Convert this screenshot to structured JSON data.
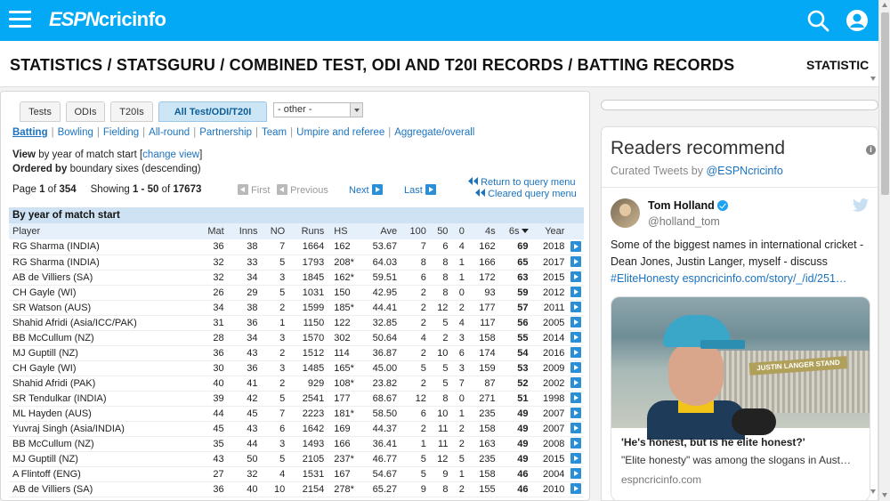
{
  "header": {
    "logo_espn": "ESPN",
    "logo_cric": "cricinfo",
    "icons": {
      "menu": "hamburger-icon",
      "search": "search-icon",
      "user": "user-icon"
    }
  },
  "title": {
    "main": "STATISTICS / STATSGURU / COMBINED TEST, ODI AND T20I RECORDS / BATTING RECORDS",
    "secondary": "STATISTIC"
  },
  "tabs": [
    {
      "label": "Tests"
    },
    {
      "label": "ODIs"
    },
    {
      "label": "T20Is"
    },
    {
      "label": "All Test/ODI/T20I",
      "active": true
    }
  ],
  "select": {
    "value": "- other -"
  },
  "subnav": [
    {
      "label": "Batting",
      "active": true
    },
    {
      "label": "Bowling"
    },
    {
      "label": "Fielding"
    },
    {
      "label": "All-round"
    },
    {
      "label": "Partnership"
    },
    {
      "label": "Team"
    },
    {
      "label": "Umpire and referee"
    },
    {
      "label": "Aggregate/overall"
    }
  ],
  "view": {
    "view_label": "View",
    "view_text": "by year of match start [",
    "change_view": "change view",
    "close_bracket": "]",
    "ordered_label": "Ordered by",
    "ordered_text": "boundary sixes (descending)"
  },
  "pager": {
    "page_label": "Page",
    "page": "1",
    "of": "of",
    "total_pages": "354",
    "showing_label": "Showing",
    "range": "1 - 50",
    "of2": "of",
    "total": "17673",
    "first": "First",
    "previous": "Previous",
    "next": "Next",
    "last": "Last",
    "return_link": "Return to query menu",
    "cleared_link": "Cleared query menu"
  },
  "table": {
    "caption": "By year of match start",
    "headers": [
      "Player",
      "Mat",
      "Inns",
      "NO",
      "Runs",
      "HS",
      "Ave",
      "100",
      "50",
      "0",
      "4s",
      "6s",
      "Year"
    ],
    "rows": [
      [
        "RG Sharma (INDIA)",
        "36",
        "38",
        "7",
        "1664",
        "162",
        "53.67",
        "7",
        "6",
        "4",
        "162",
        "69",
        "2018"
      ],
      [
        "RG Sharma (INDIA)",
        "32",
        "33",
        "5",
        "1793",
        "208*",
        "64.03",
        "8",
        "8",
        "1",
        "166",
        "65",
        "2017"
      ],
      [
        "AB de Villiers (SA)",
        "32",
        "34",
        "3",
        "1845",
        "162*",
        "59.51",
        "6",
        "8",
        "1",
        "172",
        "63",
        "2015"
      ],
      [
        "CH Gayle (WI)",
        "26",
        "29",
        "5",
        "1031",
        "150",
        "42.95",
        "2",
        "8",
        "0",
        "93",
        "59",
        "2012"
      ],
      [
        "SR Watson (AUS)",
        "34",
        "38",
        "2",
        "1599",
        "185*",
        "44.41",
        "2",
        "12",
        "2",
        "177",
        "57",
        "2011"
      ],
      [
        "Shahid Afridi (Asia/ICC/PAK)",
        "31",
        "36",
        "1",
        "1150",
        "122",
        "32.85",
        "2",
        "5",
        "4",
        "117",
        "56",
        "2005"
      ],
      [
        "BB McCullum (NZ)",
        "28",
        "34",
        "3",
        "1570",
        "302",
        "50.64",
        "4",
        "2",
        "3",
        "158",
        "55",
        "2014"
      ],
      [
        "MJ Guptill (NZ)",
        "36",
        "43",
        "2",
        "1512",
        "114",
        "36.87",
        "2",
        "10",
        "6",
        "174",
        "54",
        "2016"
      ],
      [
        "CH Gayle (WI)",
        "30",
        "36",
        "3",
        "1485",
        "165*",
        "45.00",
        "5",
        "5",
        "3",
        "159",
        "53",
        "2009"
      ],
      [
        "Shahid Afridi (PAK)",
        "40",
        "41",
        "2",
        "929",
        "108*",
        "23.82",
        "2",
        "5",
        "7",
        "87",
        "52",
        "2002"
      ],
      [
        "SR Tendulkar (INDIA)",
        "39",
        "42",
        "5",
        "2541",
        "177",
        "68.67",
        "12",
        "8",
        "0",
        "271",
        "51",
        "1998"
      ],
      [
        "ML Hayden (AUS)",
        "44",
        "45",
        "7",
        "2223",
        "181*",
        "58.50",
        "6",
        "10",
        "1",
        "235",
        "49",
        "2007"
      ],
      [
        "Yuvraj Singh (Asia/INDIA)",
        "45",
        "43",
        "6",
        "1642",
        "169",
        "44.37",
        "2",
        "11",
        "2",
        "158",
        "49",
        "2007"
      ],
      [
        "BB McCullum (NZ)",
        "35",
        "44",
        "3",
        "1493",
        "166",
        "36.41",
        "1",
        "11",
        "2",
        "163",
        "49",
        "2008"
      ],
      [
        "MJ Guptill (NZ)",
        "43",
        "50",
        "5",
        "2105",
        "237*",
        "46.77",
        "5",
        "12",
        "5",
        "235",
        "49",
        "2015"
      ],
      [
        "A Flintoff (ENG)",
        "27",
        "32",
        "4",
        "1531",
        "167",
        "54.67",
        "5",
        "9",
        "1",
        "158",
        "46",
        "2004"
      ],
      [
        "AB de Villiers (SA)",
        "36",
        "40",
        "10",
        "2154",
        "278*",
        "65.27",
        "9",
        "8",
        "2",
        "155",
        "46",
        "2010"
      ]
    ]
  },
  "readers": {
    "title": "Readers recommend",
    "curated_prefix": "Curated Tweets by ",
    "curated_handle": "@ESPNcricinfo",
    "tweet": {
      "name": "Tom Holland",
      "handle": "@holland_tom",
      "text": "Some of the biggest names in international cricket - Dean Jones, Justin Langer, myself - discuss ",
      "hashtag": "#EliteHonesty",
      "link": "espncricinfo.com/story/_/id/251…",
      "card_sign": "JUSTIN LANGER STAND",
      "card_title": "'He's honest, but is he elite honest?'",
      "card_desc": "\"Elite honesty\" was among the slogans in Aust…",
      "card_domain": "espncricinfo.com"
    }
  }
}
